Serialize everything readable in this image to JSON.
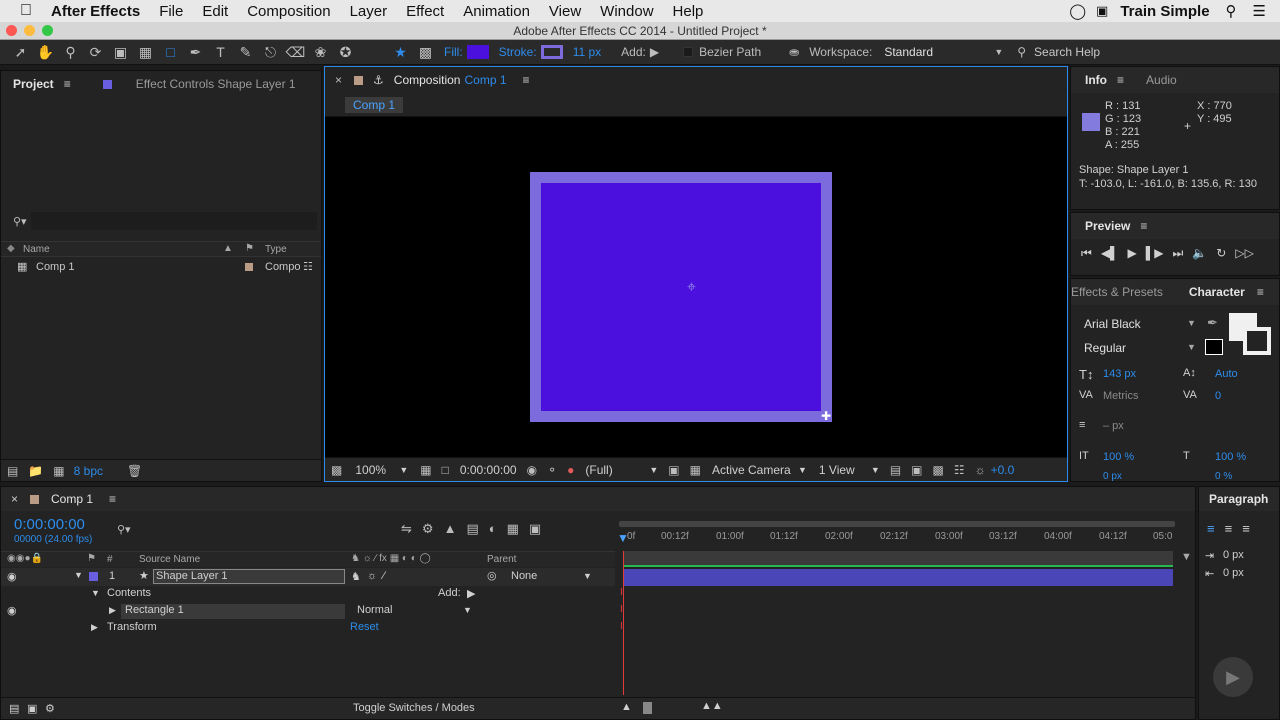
{
  "menubar": {
    "app": "After Effects",
    "items": [
      "File",
      "Edit",
      "Composition",
      "Layer",
      "Effect",
      "Animation",
      "View",
      "Window",
      "Help"
    ],
    "right_label": "Train Simple"
  },
  "window": {
    "title": "Adobe After Effects CC 2014 - Untitled Project *"
  },
  "toolbar": {
    "fill_label": "Fill:",
    "fill_color": "#4b0fde",
    "stroke_label": "Stroke:",
    "stroke_color": "#7b6bdd",
    "stroke_width": "11 px",
    "add_label": "Add:",
    "bezier_label": "Bezier Path",
    "workspace_label": "Workspace:",
    "workspace_value": "Standard",
    "search_placeholder": "Search Help"
  },
  "project_panel": {
    "tab_project": "Project",
    "tab_effects": "Effect Controls Shape Layer 1",
    "col_name": "Name",
    "col_type": "Type",
    "item_name": "Comp 1",
    "item_type": "Compo",
    "bpc": "8 bpc"
  },
  "composition_panel": {
    "tab_label": "Composition",
    "comp_name": "Comp 1",
    "breadcrumb": "Comp 1",
    "zoom": "100%",
    "timecode": "0:00:00:00",
    "resolution": "(Full)",
    "camera": "Active Camera",
    "views": "1 View",
    "exposure": "+0.0",
    "shape_fill": "#4b0fde",
    "shape_stroke": "#7b6bdd"
  },
  "info_panel": {
    "tab_info": "Info",
    "tab_audio": "Audio",
    "r": "R : 131",
    "g": "G : 123",
    "b": "B : 221",
    "a": "A : 255",
    "x": "X : 770",
    "y": "Y : 495",
    "swatch_color": "#837bdd",
    "shape_name": "Shape: Shape Layer 1",
    "shape_bounds": "T: -103.0, L: -161.0, B: 135.6, R: 130"
  },
  "preview_panel": {
    "title": "Preview"
  },
  "character_panel": {
    "tab_effects": "Effects & Presets",
    "tab_character": "Character",
    "font": "Arial Black",
    "style": "Regular",
    "size": "143 px",
    "leading": "Auto",
    "kerning": "Metrics",
    "tracking": "0",
    "stroke_width": "– px",
    "vscale": "100 %",
    "hscale": "100 %",
    "baseline": "0 px",
    "tsume": "0 %"
  },
  "paragraph_panel": {
    "title": "Paragraph",
    "indent_left": "0 px",
    "space_before": "0 px"
  },
  "timeline": {
    "tab_label": "Comp 1",
    "timecode": "0:00:00:00",
    "frames": "00000 (24.00 fps)",
    "col_num": "#",
    "col_source": "Source Name",
    "col_parent": "Parent",
    "ruler": [
      "0f",
      "00:12f",
      "01:00f",
      "01:12f",
      "02:00f",
      "02:12f",
      "03:00f",
      "03:12f",
      "04:00f",
      "04:12f",
      "05:0"
    ],
    "layer_num": "1",
    "layer_name": "Shape Layer 1",
    "parent_value": "None",
    "contents_label": "Contents",
    "add_label": "Add:",
    "rect_label": "Rectangle 1",
    "blend_mode": "Normal",
    "transform_label": "Transform",
    "reset_label": "Reset",
    "toggle_label": "Toggle Switches / Modes",
    "layer_bar_color": "#4a46b8"
  }
}
